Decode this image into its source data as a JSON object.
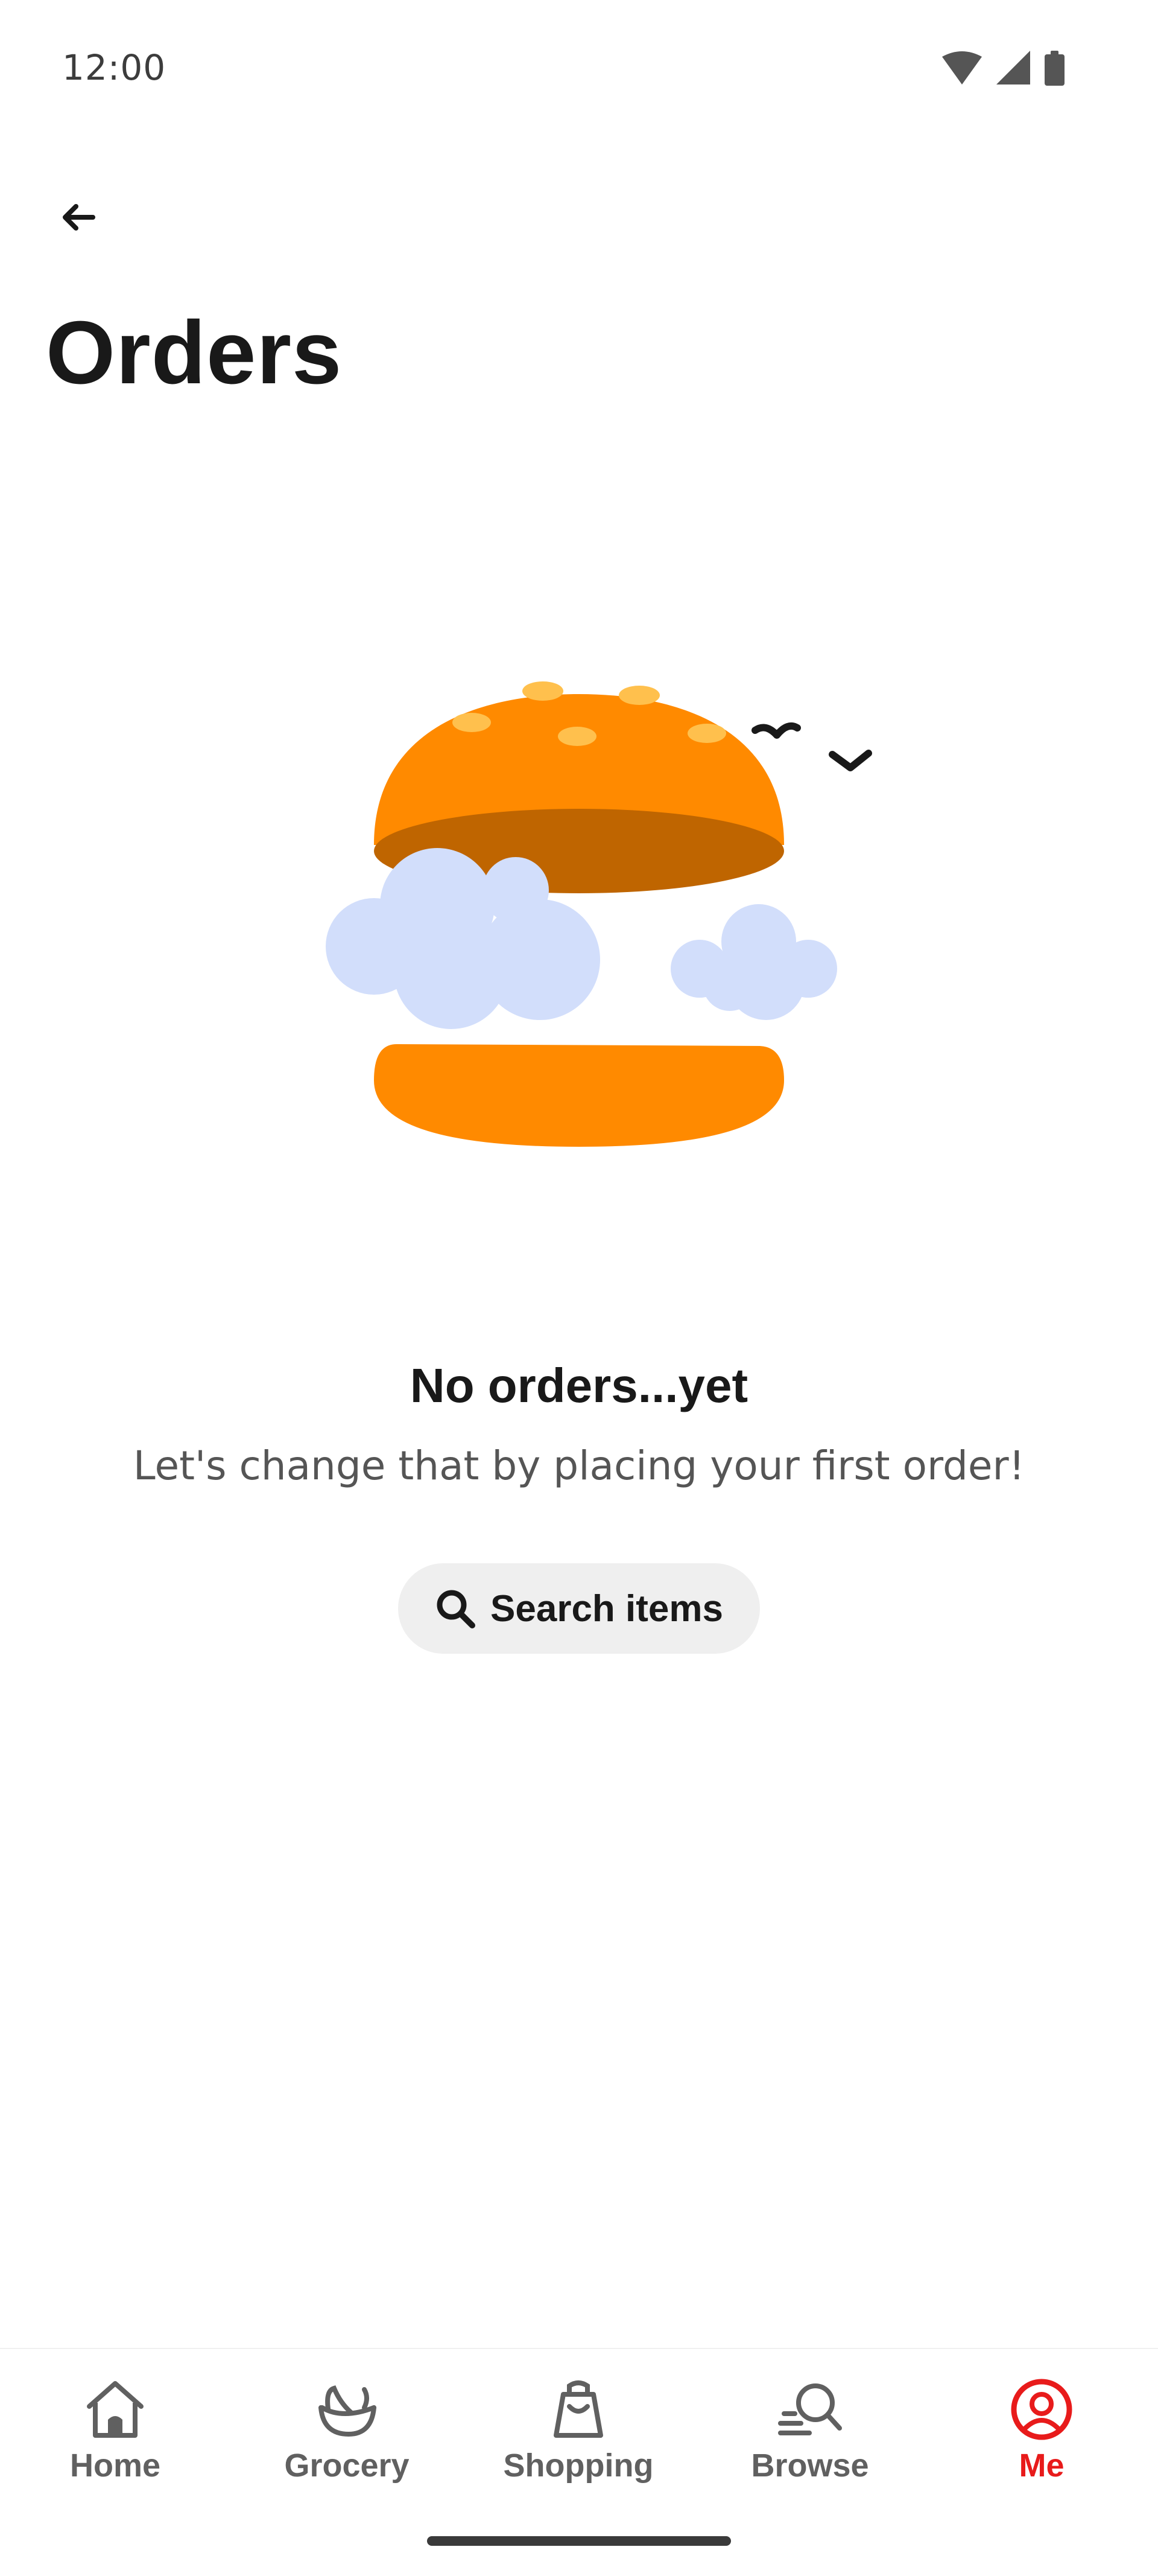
{
  "status_bar": {
    "time": "12:00",
    "icons": [
      "wifi-icon",
      "cellular-signal-icon",
      "battery-icon"
    ]
  },
  "header": {
    "back_icon": "arrow-left-icon",
    "title": "Orders"
  },
  "empty_state": {
    "illustration": "burger-with-clouds-illustration",
    "title": "No orders...yet",
    "subtitle": "Let's change that by placing your first order!",
    "search_button": {
      "icon": "search-icon",
      "label": "Search items"
    }
  },
  "bottom_nav": {
    "items": [
      {
        "label": "Home",
        "icon": "home-icon",
        "active": false
      },
      {
        "label": "Grocery",
        "icon": "grocery-bowl-icon",
        "active": false
      },
      {
        "label": "Shopping",
        "icon": "shopping-bag-icon",
        "active": false
      },
      {
        "label": "Browse",
        "icon": "browse-search-icon",
        "active": false
      },
      {
        "label": "Me",
        "icon": "profile-icon",
        "active": true
      }
    ]
  },
  "colors": {
    "accent": "#E81B1B",
    "bun_orange": "#FF8A00",
    "bun_dark": "#BF6500",
    "seed": "#FFC04D",
    "cloud": "#D2DEFB",
    "text_primary": "#191919",
    "text_secondary": "#555555",
    "nav_inactive": "#606060",
    "button_bg": "#EFEFEF"
  }
}
